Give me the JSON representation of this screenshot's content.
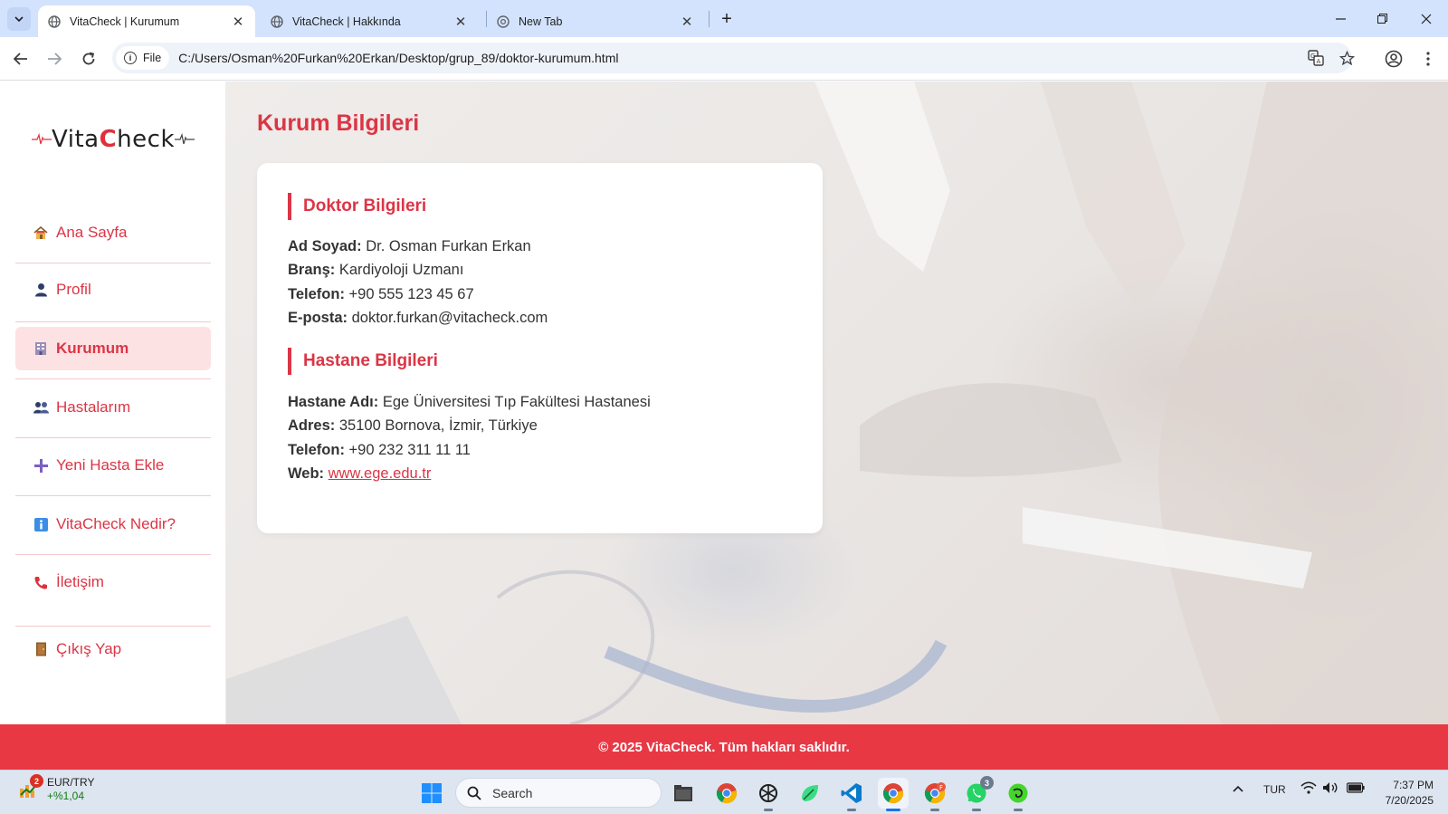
{
  "browser": {
    "tabs": [
      {
        "title": "VitaCheck | Kurumum",
        "active": true
      },
      {
        "title": "VitaCheck | Hakkında",
        "active": false
      },
      {
        "title": "New Tab",
        "active": false
      }
    ],
    "site_chip": "File",
    "url": "C:/Users/Osman%20Furkan%20Erkan/Desktop/grup_89/doktor-kurumum.html"
  },
  "sidebar": {
    "logo": {
      "prefix": "Vita",
      "accent": "C",
      "suffix": "heck"
    },
    "items": [
      {
        "label": "Ana Sayfa",
        "icon": "house-icon"
      },
      {
        "label": "Profil",
        "icon": "person-icon"
      },
      {
        "label": "Kurumum",
        "icon": "building-icon",
        "active": true
      },
      {
        "label": "Hastalarım",
        "icon": "people-icon"
      },
      {
        "label": "Yeni Hasta Ekle",
        "icon": "plus-icon"
      },
      {
        "label": "VitaCheck Nedir?",
        "icon": "info-icon"
      },
      {
        "label": "İletişim",
        "icon": "phone-icon"
      },
      {
        "label": "Çıkış Yap",
        "icon": "door-icon"
      }
    ]
  },
  "main": {
    "title": "Kurum Bilgileri",
    "doctor": {
      "heading": "Doktor Bilgileri",
      "rows": [
        {
          "label": "Ad Soyad:",
          "value": "Dr. Osman Furkan Erkan"
        },
        {
          "label": "Branş:",
          "value": "Kardiyoloji Uzmanı"
        },
        {
          "label": "Telefon:",
          "value": "+90 555 123 45 67"
        },
        {
          "label": "E-posta:",
          "value": "doktor.furkan@vitacheck.com"
        }
      ]
    },
    "hospital": {
      "heading": "Hastane Bilgileri",
      "rows": [
        {
          "label": "Hastane Adı:",
          "value": "Ege Üniversitesi Tıp Fakültesi Hastanesi"
        },
        {
          "label": "Adres:",
          "value": "35100 Bornova, İzmir, Türkiye"
        },
        {
          "label": "Telefon:",
          "value": "+90 232 311 11 11"
        },
        {
          "label": "Web:",
          "value": "www.ege.edu.tr"
        }
      ]
    }
  },
  "footer": {
    "text": "© 2025 VitaCheck. Tüm hakları saklıdır."
  },
  "taskbar": {
    "widget": {
      "title": "EUR/TRY",
      "change": "+%1,04",
      "badge": "2"
    },
    "search_placeholder": "Search",
    "whatsapp_badge": "3",
    "language": "TUR",
    "time": "7:37 PM",
    "date": "7/20/2025"
  },
  "colors": {
    "accent": "#dc3545",
    "footer": "#e83844",
    "active_nav_bg": "#fde2e4"
  }
}
